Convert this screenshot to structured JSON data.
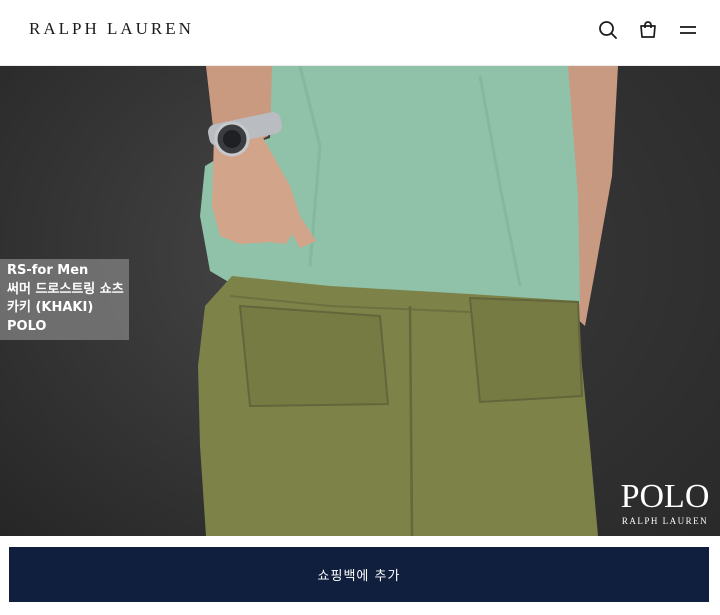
{
  "header": {
    "brand": "RALPH LAUREN",
    "icons": [
      "search-icon",
      "shopping-bag-icon",
      "hamburger-menu-icon"
    ]
  },
  "hero": {
    "caption": {
      "line1": "RS-for Men",
      "line2": "써머 드로스트링 쇼츠",
      "line3": "카키 (KHAKI)",
      "line4": "POLO"
    },
    "logo": {
      "word": "POLO",
      "sub": "RALPH LAUREN"
    }
  },
  "cta": {
    "label": "쇼핑백에 추가"
  },
  "colors": {
    "button_bg": "#0f1f3d",
    "shirt": "#8fc2a8",
    "shorts": "#7d8249",
    "backdrop": "#363636"
  }
}
